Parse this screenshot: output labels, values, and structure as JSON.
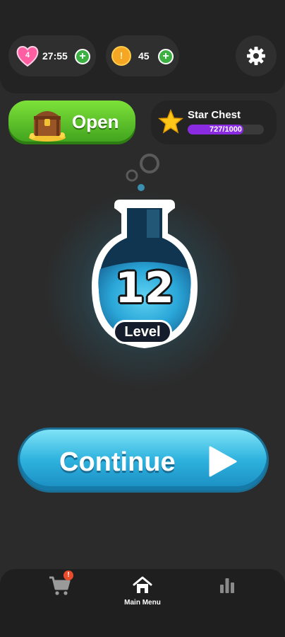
{
  "top_bar": {
    "lives": {
      "count": "4",
      "timer": "27:55",
      "add_label": "+"
    },
    "coins": {
      "symbol": "!",
      "amount": "45",
      "add_label": "+"
    },
    "settings_icon": "gear-icon"
  },
  "chest": {
    "open_label": "Open",
    "icon": "treasure-chest-icon"
  },
  "star_chest": {
    "title": "Star Chest",
    "progress_text": "727/1000",
    "progress_fraction": 0.727,
    "icon": "star-icon"
  },
  "level": {
    "number": "12",
    "label": "Level"
  },
  "continue_button": {
    "label": "Continue",
    "icon": "play-icon"
  },
  "bottom_nav": {
    "shop": {
      "icon": "cart-icon",
      "badge": "!"
    },
    "home": {
      "icon": "home-icon",
      "label": "Main Menu"
    },
    "stats": {
      "icon": "bar-chart-icon"
    }
  },
  "colors": {
    "background": "#2b2b2b",
    "green_button": "#4fb524",
    "continue_blue": "#2db2de",
    "progress_purple": "#8a2be2",
    "coin": "#f5a623",
    "heart": "#ff5fa2"
  }
}
